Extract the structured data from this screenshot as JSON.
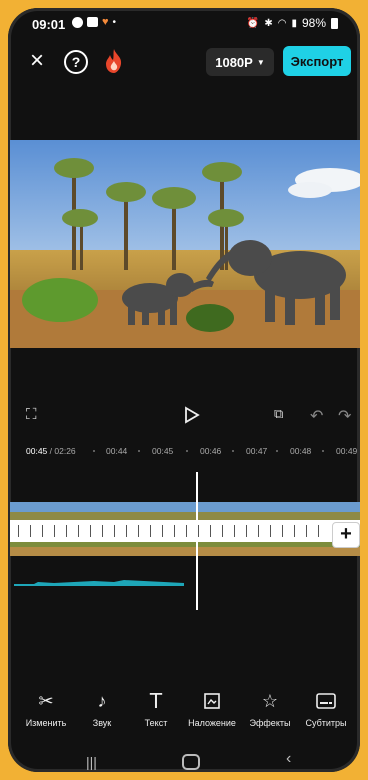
{
  "status_bar": {
    "time": "09:01",
    "battery": "98%"
  },
  "top_bar": {
    "resolution_label": "1080P",
    "export_label": "Экспорт"
  },
  "timeline_ruler": {
    "current_time": "00:45",
    "total_time": "/ 02:26",
    "marks": [
      "00:44",
      "00:45",
      "00:46",
      "00:47",
      "00:48",
      "00:49"
    ]
  },
  "toolbar": {
    "items": [
      {
        "label": "Изменить",
        "icon": "scissors-icon"
      },
      {
        "label": "Звук",
        "icon": "music-note-icon"
      },
      {
        "label": "Текст",
        "icon": "text-icon"
      },
      {
        "label": "Наложение",
        "icon": "overlay-icon"
      },
      {
        "label": "Эффекты",
        "icon": "effects-star-icon"
      },
      {
        "label": "Субтитры",
        "icon": "subtitles-icon"
      }
    ]
  },
  "colors": {
    "accent": "#1fd1e6",
    "background": "#111111",
    "frame": "#f2b134"
  }
}
